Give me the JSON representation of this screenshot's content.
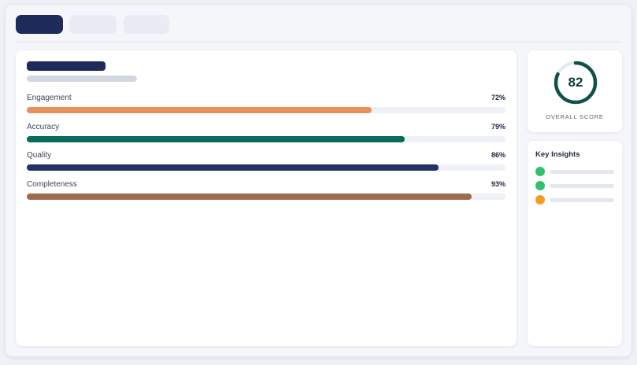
{
  "metrics": [
    {
      "label": "Engagement",
      "value_text": "72%",
      "value": 72,
      "color": "#e8925a"
    },
    {
      "label": "Accuracy",
      "value_text": "79%",
      "value": 79,
      "color": "#0a6b5a"
    },
    {
      "label": "Quality",
      "value_text": "86%",
      "value": 86,
      "color": "#23306a"
    },
    {
      "label": "Completeness",
      "value_text": "93%",
      "value": 93,
      "color": "#9e6b4c"
    }
  ],
  "score": {
    "value": "82",
    "percent": 82,
    "label": "OVERALL SCORE",
    "ring_color": "#0e5248",
    "track_color": "#e6e9ee"
  },
  "insights": {
    "title": "Key Insights",
    "items": [
      {
        "status_color": "#2ec26b"
      },
      {
        "status_color": "#2ec26b"
      },
      {
        "status_color": "#f0a020"
      }
    ]
  }
}
